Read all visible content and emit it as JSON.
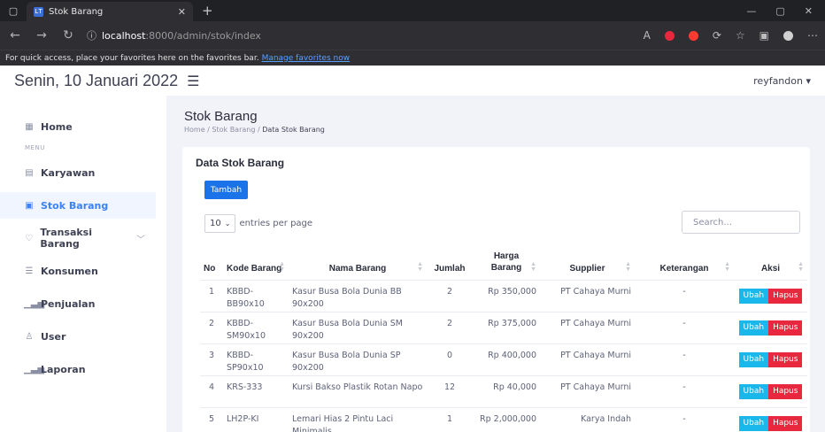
{
  "browser": {
    "tab_title": "Stok Barang",
    "url_host": "localhost",
    "url_path": ":8000/admin/stok/index",
    "favorites_text": "For quick access, place your favorites here on the favorites bar.",
    "favorites_link": "Manage favorites now"
  },
  "header": {
    "date": "Senin, 10 Januari 2022",
    "user": "reyfandon ▾"
  },
  "sidebar": {
    "home": "Home",
    "menu_label": "MENU",
    "items": [
      {
        "label": "Karyawan"
      },
      {
        "label": "Stok Barang"
      },
      {
        "label": "Transaksi Barang"
      },
      {
        "label": "Konsumen"
      },
      {
        "label": "Penjualan"
      },
      {
        "label": "User"
      },
      {
        "label": "Laporan"
      }
    ]
  },
  "page": {
    "title": "Stok Barang",
    "breadcrumb": [
      "Home",
      "Stok Barang",
      "Data Stok Barang"
    ]
  },
  "card": {
    "title": "Data Stok Barang",
    "add_label": "Tambah",
    "entries_value": "10",
    "entries_label": "entries per page",
    "search_placeholder": "Search...",
    "columns": [
      "No",
      "Kode Barang",
      "Nama Barang",
      "Jumlah",
      "Harga Barang",
      "Supplier",
      "Keterangan",
      "Aksi"
    ],
    "edit_label": "Ubah",
    "delete_label": "Hapus",
    "rows": [
      {
        "no": "1",
        "kode": "KBBD-BB90x10",
        "nama": "Kasur Busa Bola Dunia BB 90x200",
        "jumlah": "2",
        "harga": "Rp 350,000",
        "supplier": "PT Cahaya Murni",
        "ket": "-"
      },
      {
        "no": "2",
        "kode": "KBBD-SM90x10",
        "nama": "Kasur Busa Bola Dunia SM 90x200",
        "jumlah": "2",
        "harga": "Rp 375,000",
        "supplier": "PT Cahaya Murni",
        "ket": "-"
      },
      {
        "no": "3",
        "kode": "KBBD-SP90x10",
        "nama": "Kasur Busa Bola Dunia SP 90x200",
        "jumlah": "0",
        "harga": "Rp 400,000",
        "supplier": "PT Cahaya Murni",
        "ket": "-"
      },
      {
        "no": "4",
        "kode": "KRS-333",
        "nama": "Kursi Bakso Plastik Rotan Napo",
        "jumlah": "12",
        "harga": "Rp 40,000",
        "supplier": "PT Cahaya Murni",
        "ket": "-"
      },
      {
        "no": "5",
        "kode": "LH2P-KI",
        "nama": "Lemari Hias 2 Pintu Laci Minimalis",
        "jumlah": "1",
        "harga": "Rp 2,000,000",
        "supplier": "Karya Indah",
        "ket": "-"
      }
    ]
  },
  "colors": {
    "accent": "#3b82f6",
    "add_button": "#1a73e8",
    "edit_button": "#1ab7ea",
    "delete_button": "#e8283f"
  }
}
